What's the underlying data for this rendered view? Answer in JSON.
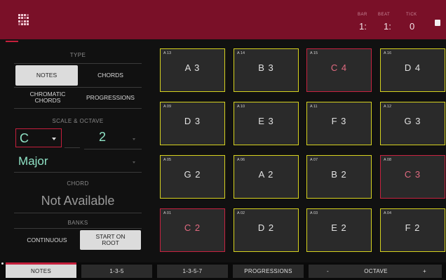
{
  "header": {
    "counters": [
      {
        "label": "BAR",
        "value": "1:"
      },
      {
        "label": "BEAT",
        "value": "1:"
      },
      {
        "label": "TICK",
        "value": "0"
      }
    ]
  },
  "panel": {
    "type_label": "TYPE",
    "type_buttons": [
      "NOTES",
      "CHORDS",
      "CHROMATIC CHORDS",
      "PROGRESSIONS"
    ],
    "scale_octave_label": "SCALE & OCTAVE",
    "key": "C",
    "octave": "2",
    "scale": "Major",
    "chord_label": "CHORD",
    "chord_value": "Not Available",
    "banks_label": "BANKS",
    "bank_buttons": [
      "CONTINUOUS",
      "START ON ROOT"
    ]
  },
  "pads": [
    {
      "id": "A 13",
      "note": "A 3",
      "highlight": "yellow"
    },
    {
      "id": "A 14",
      "note": "B 3",
      "highlight": "yellow"
    },
    {
      "id": "A 15",
      "note": "C 4",
      "highlight": "red"
    },
    {
      "id": "A 16",
      "note": "D 4",
      "highlight": "yellow"
    },
    {
      "id": "A 09",
      "note": "D 3",
      "highlight": "yellow"
    },
    {
      "id": "A 10",
      "note": "E 3",
      "highlight": "yellow"
    },
    {
      "id": "A 11",
      "note": "F 3",
      "highlight": "yellow"
    },
    {
      "id": "A 12",
      "note": "G 3",
      "highlight": "yellow"
    },
    {
      "id": "A 05",
      "note": "G 2",
      "highlight": "yellow"
    },
    {
      "id": "A 06",
      "note": "A 2",
      "highlight": "yellow"
    },
    {
      "id": "A 07",
      "note": "B 2",
      "highlight": "yellow"
    },
    {
      "id": "A 08",
      "note": "C 3",
      "highlight": "red"
    },
    {
      "id": "A 01",
      "note": "C 2",
      "highlight": "red"
    },
    {
      "id": "A 02",
      "note": "D 2",
      "highlight": "yellow"
    },
    {
      "id": "A 03",
      "note": "E 2",
      "highlight": "yellow"
    },
    {
      "id": "A 04",
      "note": "F 2",
      "highlight": "yellow"
    }
  ],
  "bottom_tabs": {
    "notes": "NOTES",
    "t135": "1-3-5",
    "t1357": "1-3-5-7",
    "progressions": "PROGRESSIONS",
    "minus": "-",
    "octave": "OCTAVE",
    "plus": "+"
  },
  "colors": {
    "header_bg": "#7a1028",
    "accent_red": "#c51f3c",
    "pad_yellow": "#d6d21f",
    "pad_red": "#c72340",
    "teal": "#8fe2c5"
  }
}
